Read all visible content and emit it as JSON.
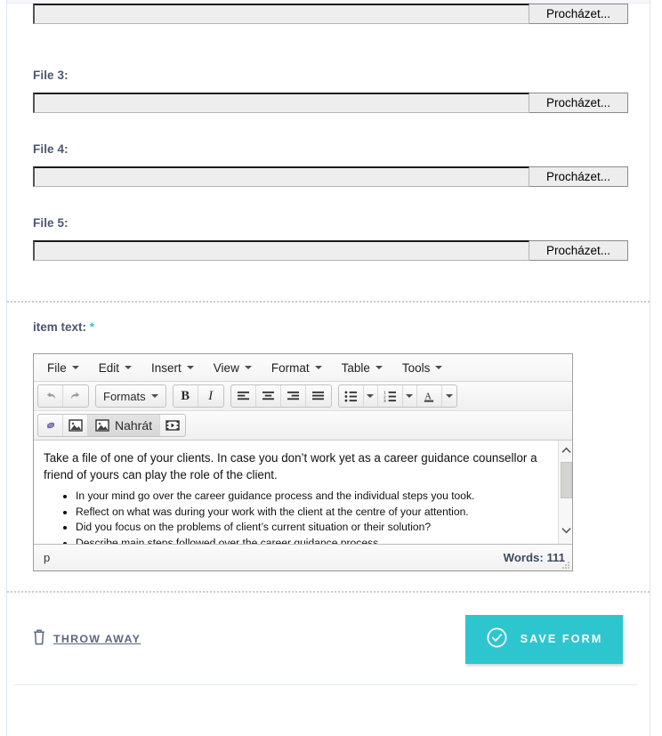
{
  "form": {
    "file_fields": [
      {
        "label": "",
        "value": "",
        "browse_label": "Procházet..."
      },
      {
        "label": "File 3:",
        "value": "",
        "browse_label": "Procházet..."
      },
      {
        "label": "File 4:",
        "value": "",
        "browse_label": "Procházet..."
      },
      {
        "label": "File 5:",
        "value": "",
        "browse_label": "Procházet..."
      }
    ],
    "editor_field": {
      "label": "item text:",
      "required_marker": "*"
    }
  },
  "editor": {
    "menubar": [
      {
        "label": "File"
      },
      {
        "label": "Edit"
      },
      {
        "label": "Insert"
      },
      {
        "label": "View"
      },
      {
        "label": "Format"
      },
      {
        "label": "Table"
      },
      {
        "label": "Tools"
      }
    ],
    "toolbar_row1": {
      "undo": "↶",
      "redo": "↷",
      "formats_label": "Formats",
      "bold": "B",
      "italic": "I",
      "align_left": "align-left",
      "align_center": "align-center",
      "align_right": "align-right",
      "align_justify": "align-justify",
      "bullet_list": "bullet-list",
      "numbered_list": "numbered-list",
      "text_color": "A"
    },
    "toolbar_row2": {
      "link": "link",
      "image": "image",
      "upload_label": "Nahrát",
      "media": "media"
    },
    "content": {
      "paragraph": "Take a file of one of your clients. In case you don’t work yet as a career guidance counsellor a friend of yours can play the role of the client.",
      "bullets": [
        "In your mind go over the career guidance process and the individual steps you took.",
        "Reflect on what was during your work with the client at the centre of your attention.",
        "Did you focus on the problems of client’s current situation or their solution?",
        "Describe main steps followed over the career guidance process."
      ]
    },
    "statusbar": {
      "path": "p",
      "word_count": "Words: 111"
    }
  },
  "footer": {
    "discard_label": "THROW AWAY",
    "save_label": "SAVE FORM"
  },
  "colors": {
    "accent": "#2ec6ce",
    "label": "#4c5670",
    "link": "#5c677f"
  }
}
